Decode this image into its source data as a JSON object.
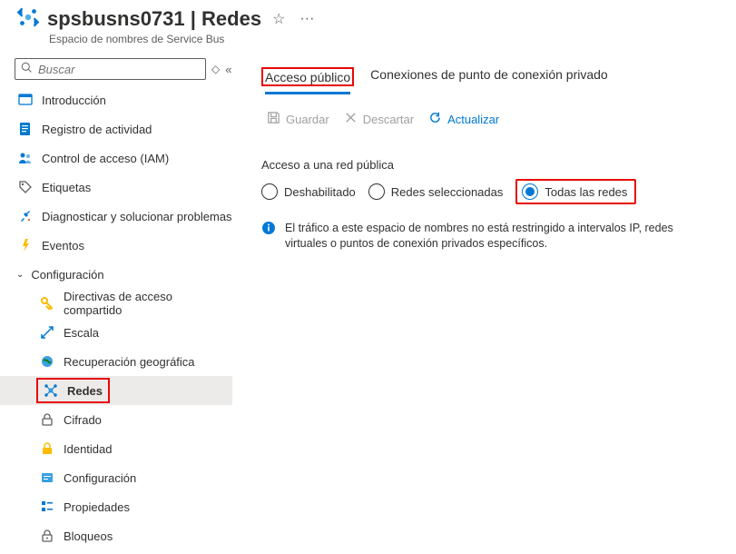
{
  "header": {
    "title": "spsbusns0731 | Redes",
    "subtitle": "Espacio de nombres de Service Bus"
  },
  "search": {
    "placeholder": "Buscar"
  },
  "sidebar": {
    "items": {
      "overview": "Introducción",
      "activity": "Registro de actividad",
      "iam": "Control de acceso (IAM)",
      "tags": "Etiquetas",
      "diagnose": "Diagnosticar y solucionar problemas",
      "events": "Eventos"
    },
    "section": "Configuración",
    "subitems": {
      "policies": "Directivas de acceso compartido",
      "scale": "Escala",
      "geo": "Recuperación geográfica",
      "networking": "Redes",
      "encryption": "Cifrado",
      "identity": "Identidad",
      "config": "Configuración",
      "properties": "Propiedades",
      "locks": "Bloqueos"
    }
  },
  "tabs": {
    "public": "Acceso público",
    "private": "Conexiones de punto de conexión privado"
  },
  "toolbar": {
    "save": "Guardar",
    "discard": "Descartar",
    "refresh": "Actualizar"
  },
  "panel": {
    "group_label": "Acceso a una red pública",
    "options": {
      "disabled": "Deshabilitado",
      "selected_networks": "Redes seleccionadas",
      "all_networks": "Todas las redes"
    },
    "info": "El tráfico a este espacio de nombres no está restringido a intervalos IP, redes virtuales o puntos de conexión privados específicos."
  }
}
